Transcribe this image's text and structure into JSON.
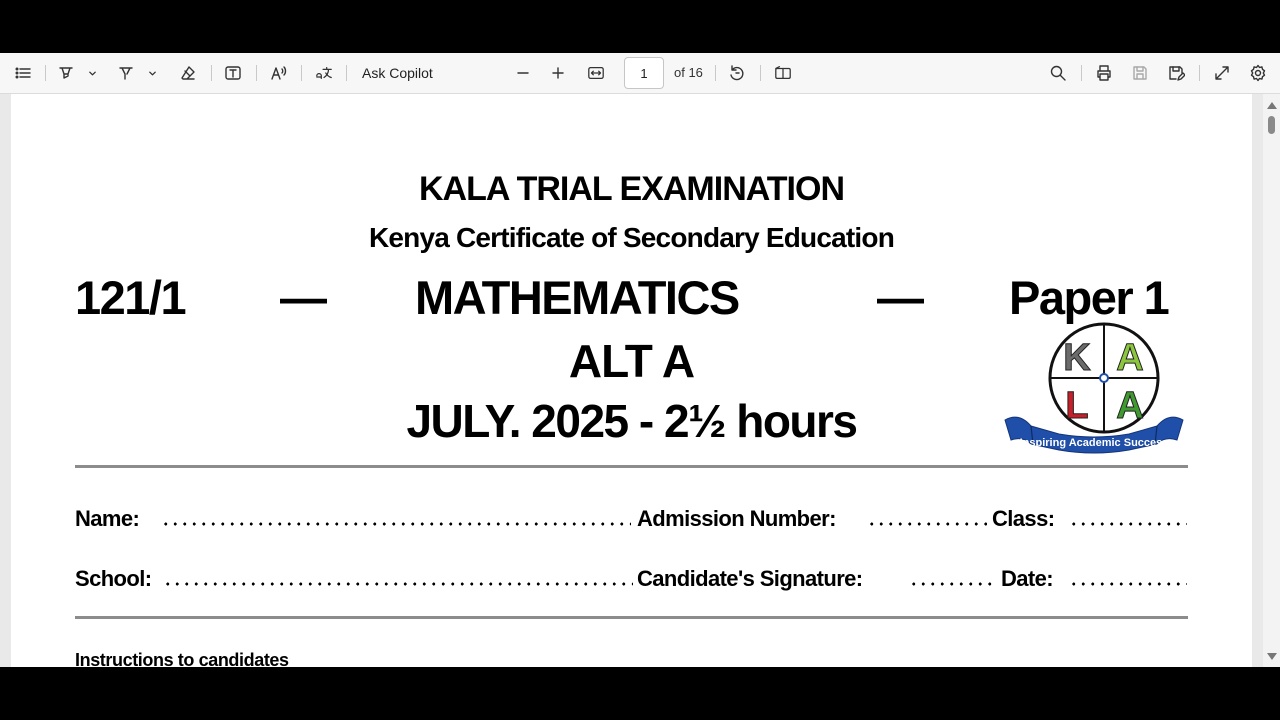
{
  "toolbar": {
    "copilot_label": "Ask Copilot",
    "page_current": "1",
    "page_of": "of 16",
    "icons": [
      "contents-icon",
      "highlight-icon",
      "draw-icon",
      "erase-icon",
      "text-box-icon",
      "read-aloud-icon",
      "translate-icon",
      "zoom-out-icon",
      "zoom-in-icon",
      "fit-width-icon",
      "rotate-icon",
      "page-view-icon",
      "search-icon",
      "print-icon",
      "save-icon",
      "save-as-icon",
      "fullscreen-icon",
      "settings-icon"
    ]
  },
  "document": {
    "title": "KALA TRIAL EXAMINATION",
    "subtitle": "Kenya Certificate of Secondary Education",
    "code": "121/1",
    "dash": "—",
    "subject": "MATHEMATICS",
    "paper": "Paper 1",
    "variant": "ALT A",
    "date_duration": "JULY. 2025 - 2½ hours",
    "fields": {
      "name": "Name:",
      "admission": "Admission Number:",
      "class": "Class:",
      "school": "School:",
      "signature": "Candidate's Signature:",
      "date": "Date:"
    },
    "instructions_heading": "Instructions to candidates",
    "logo": {
      "letters": [
        "K",
        "A",
        "L",
        "A"
      ],
      "tagline": "Inspiring Academic Success"
    }
  },
  "colors": {
    "logo_blue": "#1f4fa8",
    "logo_green": "#3f9a2f",
    "logo_red": "#c8202a",
    "logo_gray": "#6b6b6b"
  }
}
